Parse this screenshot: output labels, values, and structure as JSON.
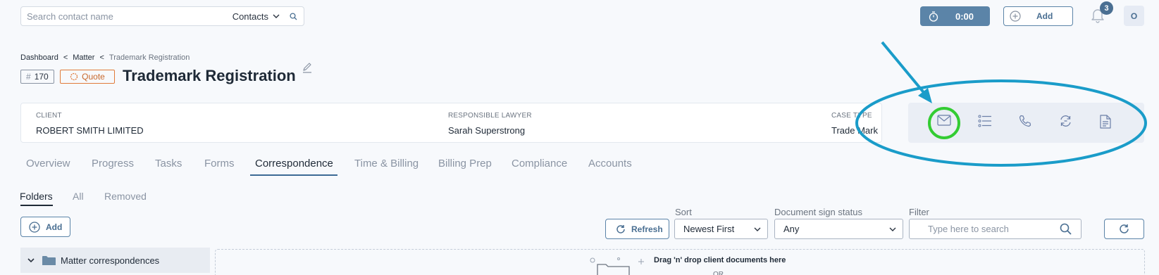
{
  "topbar": {
    "search_placeholder": "Search contact name",
    "search_scope": "Contacts",
    "timer": "0:00",
    "add_label": "Add",
    "notification_count": "3",
    "avatar_initial": "O"
  },
  "breadcrumb": {
    "items": [
      "Dashboard",
      "Matter",
      "Trademark Registration"
    ],
    "separator": "<"
  },
  "matter": {
    "hash": "#",
    "number": "170",
    "status": "Quote",
    "title": "Trademark Registration"
  },
  "info": {
    "client_label": "CLIENT",
    "client_value": "ROBERT SMITH LIMITED",
    "lawyer_label": "RESPONSIBLE LAWYER",
    "lawyer_value": "Sarah Superstrong",
    "case_type_label": "CASE TYPE",
    "case_type_value": "Trade Mark"
  },
  "actions": [
    "mail-icon",
    "list-icon",
    "phone-icon",
    "sync-icon",
    "document-icon"
  ],
  "tabs": [
    "Overview",
    "Progress",
    "Tasks",
    "Forms",
    "Correspondence",
    "Time & Billing",
    "Billing Prep",
    "Compliance",
    "Accounts"
  ],
  "active_tab": "Correspondence",
  "subtabs": [
    "Folders",
    "All",
    "Removed"
  ],
  "active_subtab": "Folders",
  "toolbar": {
    "add_label": "Add",
    "refresh_label": "Refresh",
    "sort_label": "Sort",
    "sort_value": "Newest First",
    "sign_label": "Document sign status",
    "sign_value": "Any",
    "filter_label": "Filter",
    "filter_placeholder": "Type here to search"
  },
  "folder": {
    "name": "Matter correspondences"
  },
  "dropzone": {
    "text": "Drag 'n' drop client documents here",
    "or": "OR"
  },
  "colors": {
    "accent": "#5b84a8",
    "annotation_arrow": "#1a9cc9",
    "annotation_circle": "#33cc33",
    "quote": "#e07b3a"
  }
}
